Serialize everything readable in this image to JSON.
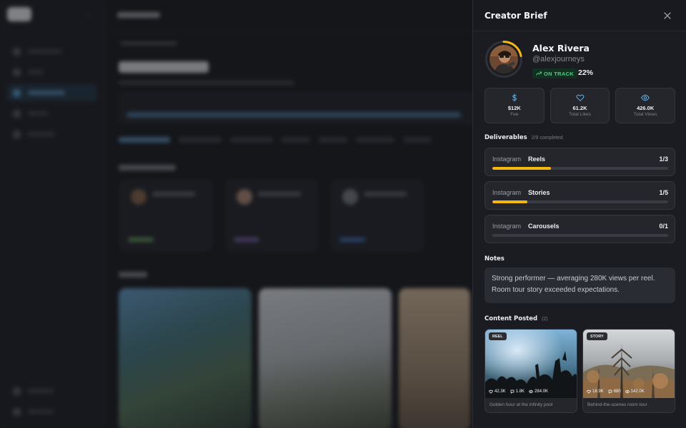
{
  "panel": {
    "title": "Creator Brief",
    "close_icon": "close-icon"
  },
  "creator": {
    "name": "Alex Rivera",
    "handle": "@alexjourneys",
    "status": "ON TRACK",
    "progress_pct": "22%",
    "progress_fraction": 0.22
  },
  "stats": [
    {
      "icon": "dollar-icon",
      "value": "$12K",
      "label": "Fee"
    },
    {
      "icon": "heart-icon",
      "value": "61.2K",
      "label": "Total Likes"
    },
    {
      "icon": "eye-icon",
      "value": "426.0K",
      "label": "Total Views"
    }
  ],
  "deliverables": {
    "title": "Deliverables",
    "summary": "2/9 completed",
    "items": [
      {
        "platform": "Instagram",
        "type": "Reels",
        "count": "1/3",
        "fraction": 0.333
      },
      {
        "platform": "Instagram",
        "type": "Stories",
        "count": "1/5",
        "fraction": 0.2
      },
      {
        "platform": "Instagram",
        "type": "Carousels",
        "count": "0/1",
        "fraction": 0
      }
    ]
  },
  "notes": {
    "title": "Notes",
    "text": "Strong performer — averaging 280K views per reel. Room tour story exceeded expectations."
  },
  "content_posted": {
    "title": "Content Posted",
    "count": "(2)",
    "posts": [
      {
        "badge": "REEL",
        "likes": "42.3K",
        "comments": "1.8K",
        "views": "284.0K",
        "caption": "Golden hour at the infinity pool"
      },
      {
        "badge": "STORY",
        "likes": "18.9K",
        "comments": "680",
        "views": "142.0K",
        "caption": "Behind-the-scenes room tour"
      }
    ]
  },
  "colors": {
    "accent": "#f5b80f",
    "status_green": "#46d17c",
    "stat_icon": "#5fb3e8"
  }
}
